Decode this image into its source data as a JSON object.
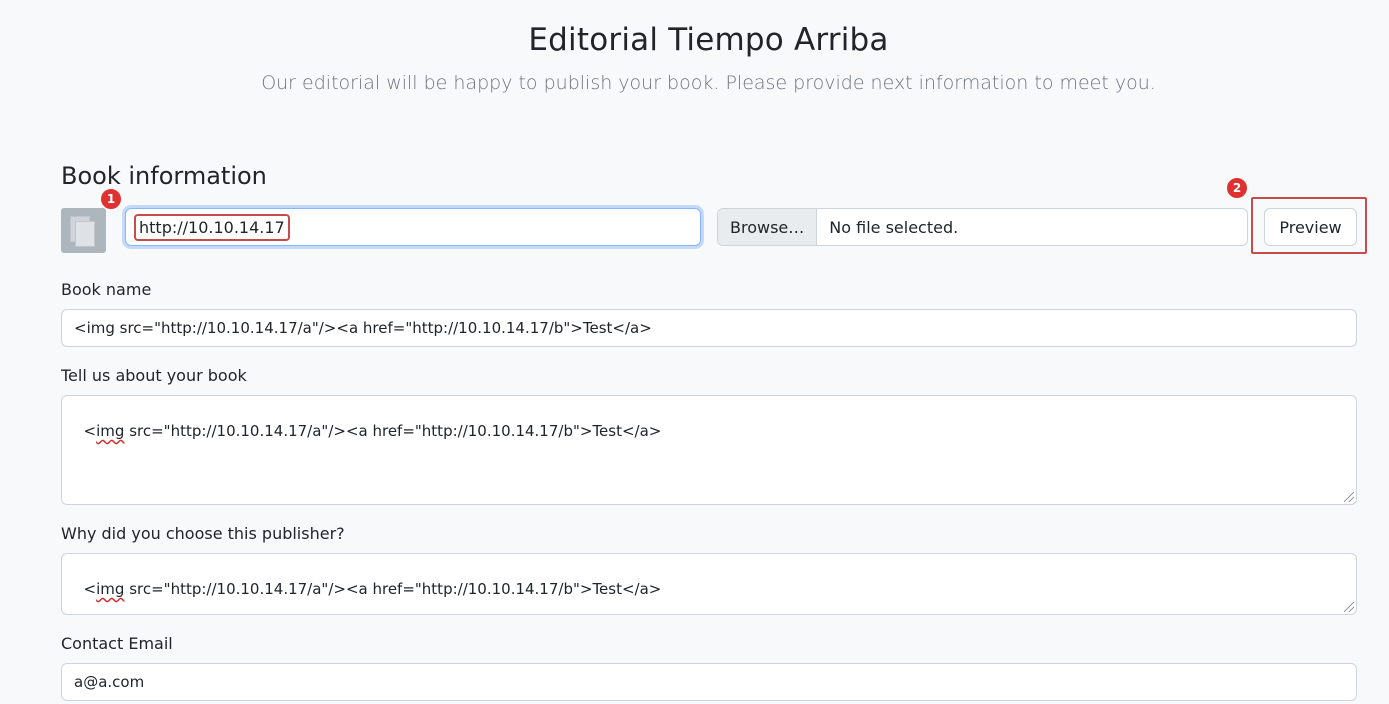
{
  "header": {
    "title": "Editorial Tiempo Arriba",
    "subtitle": "Our editorial will be happy to publish your book. Please provide next information to meet you."
  },
  "book_info": {
    "section_title": "Book information",
    "cover_url_value": "http://10.10.14.17",
    "file_browse_label": "Browse…",
    "file_status": "No file selected.",
    "preview_label": "Preview",
    "annotations": [
      "1",
      "2"
    ]
  },
  "form": {
    "book_name": {
      "label": "Book name",
      "value": "<img src=\"http://10.10.14.17/a\"/><a href=\"http://10.10.14.17/b\">Test</a>"
    },
    "about": {
      "label": "Tell us about your book",
      "value_prefix": "<",
      "value_misspelled": "img",
      "value_rest": " src=\"http://10.10.14.17/a\"/><a href=\"http://10.10.14.17/b\">Test</a>"
    },
    "why_publisher": {
      "label": "Why did you choose this publisher?",
      "value_prefix": "<",
      "value_misspelled": "img",
      "value_rest": " src=\"http://10.10.14.17/a\"/><a href=\"http://10.10.14.17/b\">Test</a>"
    },
    "email": {
      "label": "Contact Email",
      "value": "a@a.com"
    }
  },
  "colors": {
    "annotation_red": "#e03131",
    "highlight_border": "#c94a4a",
    "focus_border": "#86b7fe"
  }
}
